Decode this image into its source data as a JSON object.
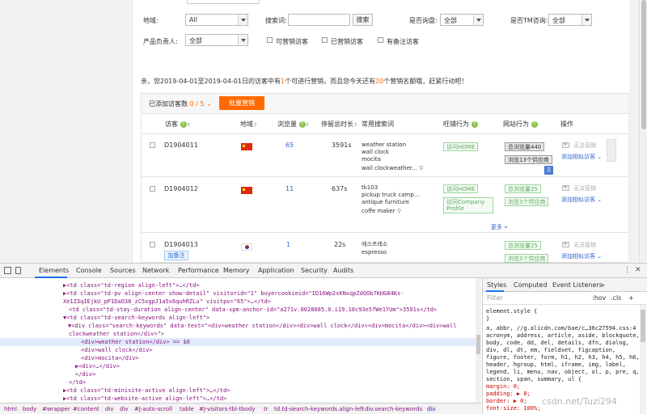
{
  "filters": {
    "region_label": "地域:",
    "region_value": "All",
    "search_label": "搜索词:",
    "search_button": "搜索",
    "inquiry_label": "是否询盘:",
    "inquiry_value": "全部",
    "tm_label": "是否TM咨询:",
    "tm_value": "全部",
    "owner_label": "产品负责人:",
    "owner_value": "全部",
    "chk_marketable": "可营销访客",
    "chk_marketed": "已营销访客",
    "chk_noted": "有备注访客"
  },
  "notice": {
    "prefix": "亲，您2019-04-01至2019-04-01日的访客中有",
    "n1": "1",
    "mid": "个可进行营销，而且您今天还有",
    "n2": "20",
    "suffix": "个营销名额哦，赶紧行动吧！"
  },
  "toolbar": {
    "added_label": "已添加访客数",
    "added_count": "0 / 5",
    "batch_button": "批量营销"
  },
  "columns": {
    "visitor": "访客",
    "region": "地域",
    "views": "浏览量",
    "duration": "停留总时长",
    "keywords": "常用搜索词",
    "shop_behavior": "旺铺行为",
    "site_behavior": "网站行为",
    "ops": "操作"
  },
  "rows": [
    {
      "id": "D1904011",
      "views": "65",
      "duration": "3591s",
      "keywords": [
        "weather station",
        "wall clock",
        "mocita",
        "wall clockweather..."
      ],
      "shop": [
        "访问HOME"
      ],
      "site": [
        "总浏览量440",
        "浏览13个供应商"
      ],
      "op1": "无法营销",
      "op2": "添加相似访客"
    },
    {
      "id": "D1904012",
      "views": "11",
      "duration": "637s",
      "keywords": [
        "tk103",
        "pickup truck camp...",
        "antique furniture",
        "coffe maker"
      ],
      "shop": [
        "访问HOME",
        "访问Company",
        "Profile"
      ],
      "site": [
        "总浏览量25",
        "浏览3个供应商"
      ],
      "op1": "无法营销",
      "op2": "添加相似访客",
      "more": "更多"
    },
    {
      "id": "D1904013",
      "note_button": "加备注",
      "views": "1",
      "duration": "22s",
      "keywords": [
        "에스프레소",
        "espresso"
      ],
      "site": [
        "总浏览量25",
        "浏览3个供应商"
      ],
      "op1": "无法营销",
      "op2": "添加相似访客"
    }
  ],
  "devtools": {
    "tabs": [
      "Elements",
      "Console",
      "Sources",
      "Network",
      "Performance",
      "Memory",
      "Application",
      "Security",
      "Audits"
    ],
    "lines": [
      "▶<td class=\"td-region align-left\">…</td>",
      "▶<td class=\"td-pv align-center show-detail\" visitorid=\"1\" buyercookieid=\"ID16Wp2sKNxqpZdQOb7KHG84Ks-",
      "Xe1Z3qIEjkU_pP1DaO38_zC5xgpJ1a5s6quhRZLu\" visitpv=\"65\">…</td>",
      "<td class=\"td-stay-duration align-center\" data-spm-anchor-id=\"a271v.8028085.0.i19.10c93e5fWe1YUm\">3591s</td>",
      "▼<td class=\"td-search-keywords align-left\">",
      "▼<div class=\"search-keywords\" data-text=\"<div>weather station</div><div>wall clock</div><div>mocita</div><div>wall",
      "clockweather station</div>\">",
      "<div>weather station</div> == $0",
      "<div>wall clock</div>",
      "<div>mocita</div>",
      "▶<div>…</div>",
      "</div>",
      "</td>",
      "▶<td class=\"td-minisite-active align-left\">…</td>",
      "▶<td class=\"td-website-active align-left\">…</td>"
    ],
    "crumbs": [
      "html",
      "body",
      "#wrapper",
      "#content",
      "div",
      "div",
      "#J-auto-scroll",
      "table",
      "#J-visitors-tbl-tbody",
      "tr",
      "td.td-search-keywords.align-left",
      "div.search-keywords",
      "div"
    ],
    "styles_tabs": [
      "Styles",
      "Computed",
      "Event Listeners",
      "»"
    ],
    "filter_placeholder": "Filter",
    "filter_hov": ":hov",
    "filter_cls": ".cls",
    "filter_plus": "+",
    "style_lines": [
      "element.style {",
      "}",
      "a, abbr,        //g.alicdn.com/bae/c…36c27594.css:4",
      "acronym, address, article, aside, blockquote,",
      "body, code, dd, del, details, dfn, dialog,",
      "div, dl, dt, em, fieldset, figcaption,",
      "figure, footer, form, h1, h2, h3, h4, h5, h6,",
      "header, hgroup, html, iframe, img, label,",
      "legend, li, menu, nav, object, ol, p, pre, q,",
      "section, span, summary, ul {",
      "  margin: 0;",
      "  padding: ▶ 0;",
      "  border: ▶ 0;",
      "  font-size: 100%;"
    ],
    "watermark": "csdn.net/Tuzi294"
  }
}
